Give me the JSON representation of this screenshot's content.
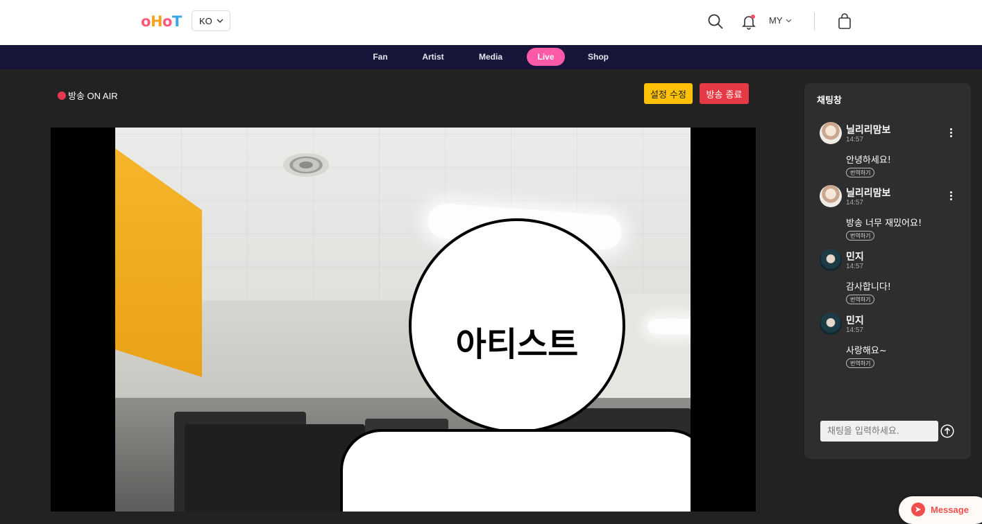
{
  "header": {
    "logo": {
      "part1": "o",
      "part2": "H",
      "part3": "o",
      "part4": "T"
    },
    "language": "KO",
    "my_label": "MY"
  },
  "nav": {
    "items": [
      {
        "label": "Fan"
      },
      {
        "label": "Artist"
      },
      {
        "label": "Media"
      },
      {
        "label": "Live"
      },
      {
        "label": "Shop"
      }
    ],
    "active": "Live"
  },
  "broadcast": {
    "status": "방송 ON AIR",
    "settings_button": "설정 수정",
    "end_button": "방송 종료",
    "artist_placeholder": "아티스트"
  },
  "chat": {
    "title": "채팅창",
    "messages": [
      {
        "user": "닐리리맘보",
        "time": "14:57",
        "text": "안녕하세요!",
        "translate": "번역하기"
      },
      {
        "user": "닐리리맘보",
        "time": "14:57",
        "text": "방송 너무 재밌어요!",
        "translate": "번역하기"
      },
      {
        "user": "민지",
        "time": "14:57",
        "text": "감사합니다!",
        "translate": "번역하기"
      },
      {
        "user": "민지",
        "time": "14:57",
        "text": "사랑해요~",
        "translate": "번역하기"
      }
    ],
    "input_placeholder": "채팅을 입력하세요."
  },
  "fab": {
    "label": "Message"
  },
  "colors": {
    "accent_pink": "#ff5aa8",
    "nav_bg": "#17163a",
    "onair_red": "#e8384f",
    "settings_yellow": "#ffc107",
    "end_red": "#e63946"
  },
  "icons": [
    "chevron-down-icon",
    "search-icon",
    "bell-icon",
    "bag-icon",
    "kebab-icon",
    "send-icon",
    "message-icon"
  ]
}
